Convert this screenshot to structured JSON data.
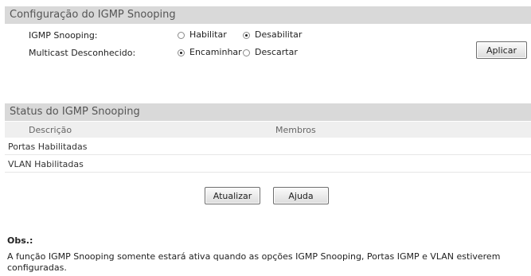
{
  "config_section": {
    "title": "Configuração do IGMP Snooping",
    "igmp_label": "IGMP Snooping:",
    "igmp_options": [
      {
        "label": "Habilitar",
        "checked": false
      },
      {
        "label": "Desabilitar",
        "checked": true
      }
    ],
    "multicast_label": "Multicast Desconhecido:",
    "multicast_options": [
      {
        "label": "Encaminhar",
        "checked": true
      },
      {
        "label": "Descartar",
        "checked": false
      }
    ],
    "apply_button": "Aplicar"
  },
  "status_section": {
    "title": "Status do IGMP Snooping",
    "columns": [
      "Descrição",
      "Membros"
    ],
    "rows": [
      {
        "description": "Portas Habilitadas",
        "members": ""
      },
      {
        "description": "VLAN Habilitadas",
        "members": ""
      }
    ],
    "refresh_button": "Atualizar",
    "help_button": "Ajuda"
  },
  "note": {
    "title": "Obs.:",
    "text": "A função IGMP Snooping somente estará ativa quando as opções IGMP Snooping, Portas IGMP e VLAN estiverem configuradas."
  }
}
